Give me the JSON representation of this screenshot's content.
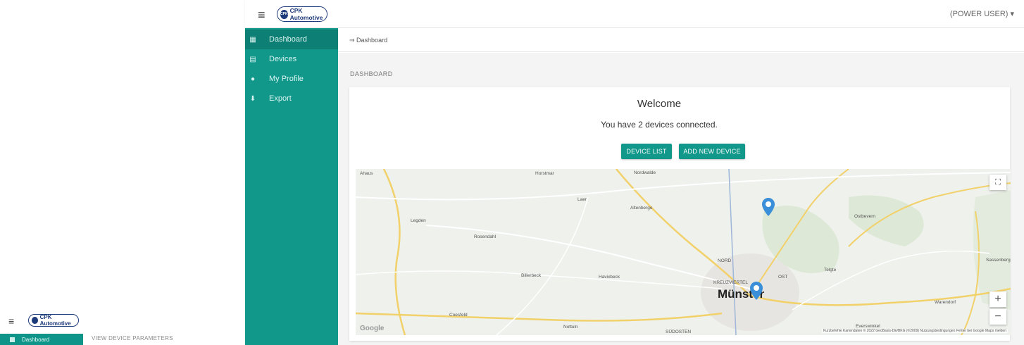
{
  "topbar": {
    "logo_text": "CPK Automotive",
    "user_menu": "(POWER USER) ▾"
  },
  "sidebar": {
    "items": [
      {
        "label": "Dashboard",
        "icon": "dashboard-icon"
      },
      {
        "label": "Devices",
        "icon": "devices-icon"
      },
      {
        "label": "My Profile",
        "icon": "person-icon"
      },
      {
        "label": "Export",
        "icon": "download-icon"
      }
    ]
  },
  "breadcrumb": "⇒ Dashboard",
  "page_title": "DASHBOARD",
  "welcome": {
    "title": "Welcome",
    "message": "You have 2 devices connected.",
    "device_list_button": "DEVICE LIST",
    "add_device_button": "ADD NEW DEVICE"
  },
  "map": {
    "labels": {
      "ahaus": "Ahaus",
      "horstmar": "Horstmar",
      "nordwalde": "Nordwalde",
      "laer": "Laer",
      "altenberge": "Altenberge",
      "legden": "Legden",
      "rosendahl": "Rosendahl",
      "ostbevern": "Ostbevern",
      "billerbeck": "Billerbeck",
      "havixbeck": "Havixbeck",
      "nord": "NORD",
      "kreuzviertel": "KREUZVIERTEL",
      "ost": "OST",
      "telgte": "Telgte",
      "sassenberg": "Sassenberg",
      "munster": "Münster",
      "coesfeld": "Coesfeld",
      "nottuln": "Nottuln",
      "warendorf": "Warendorf",
      "everswinkel": "Everswinkel",
      "sudosten": "SÜDOSTEN",
      "google": "Google"
    },
    "zoom_in": "+",
    "zoom_out": "−",
    "fullscreen_icon": "fullscreen-icon",
    "footer": "Kurzbefehle   Kartendaten © 2022 GeoBasis-DE/BKG (©2009)   Nutzungsbedingungen   Fehler bei Google Maps melden",
    "markers": 2
  },
  "mini": {
    "menu_icon": "≡",
    "logo_text": "CPK Automotive",
    "sidebar_label": "Dashboard",
    "crumb": "VIEW DEVICE PARAMETERS"
  },
  "colors": {
    "sidebar": "#12988b",
    "sidebar_active": "#0d7f74",
    "button": "#12988b",
    "marker": "#3b8ed8",
    "logo": "#1d3a7a"
  }
}
